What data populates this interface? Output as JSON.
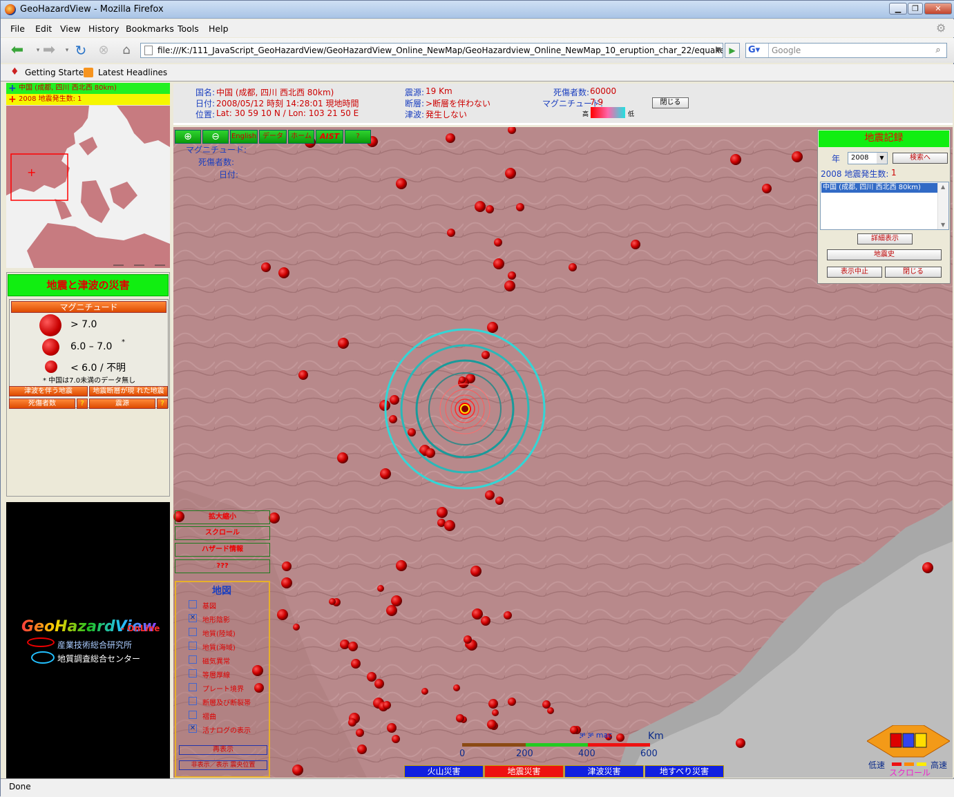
{
  "window": {
    "title": "GeoHazardView - Mozilla Firefox"
  },
  "menu": [
    "File",
    "Edit",
    "View",
    "History",
    "Bookmarks",
    "Tools",
    "Help"
  ],
  "nav": {
    "url": "file:///K:/111_JavaScript_GeoHazardView/GeoHazardView_Online_NewMap/GeoHazardview_Online_NewMap_10_eruption_char_22/equake_j_1.htm",
    "search_placeholder": "Google"
  },
  "bookmarks": [
    "Getting Started",
    "Latest Headlines"
  ],
  "left": {
    "bar1": "中国 (成都, 四川 西北西 80km)",
    "bar2": "2008 地震発生数: 1",
    "legend_title": "地震と津波の災害",
    "magnitude_label": "マグニチュード",
    "mag_items": [
      "> 7.0",
      "6.0 – 7.0",
      "< 6.0 / 不明"
    ],
    "asterisk": "*",
    "note": "*  中国は7.0未満のデータ無し",
    "btn_tsunami": "津波を伴う地震",
    "btn_fault": "地震断層が現 れた地震",
    "btn_deaths": "死傷者数",
    "btn_hypo": "震源",
    "q": "?",
    "logo_main": "GeoHazardView",
    "logo_sub": "- OnLine",
    "org1": "産業技術総合研究所",
    "org2": "地質調査総合センター"
  },
  "info": {
    "country_label": "国名:",
    "country": "中国 (成都, 四川 西北西 80km)",
    "date_label": "日付:",
    "date": "2008/05/12 時刻 14:28:01 現地時間",
    "pos_label": "位置:",
    "pos": "Lat: 30 59 10 N / Lon: 103 21 50 E",
    "depth_label": "震源:",
    "depth": "19 Km",
    "fault_label": "断層:",
    "fault": ">断層を伴わない",
    "tsunami_label": "津波:",
    "tsunami": "発生しない",
    "deaths_label": "死傷者数:",
    "deaths": "60000",
    "mag_label": "マグニチュード:",
    "mag": "7.9",
    "high": "高",
    "low": "低",
    "close": "閉じる"
  },
  "toolbar": {
    "zoom_in": "⊕",
    "zoom_out": "⊖",
    "english": "English",
    "data": "データ",
    "home": "ホーム",
    "aist": "AIST",
    "help": "?"
  },
  "map_labels": {
    "mag": "マグニチュード:",
    "deaths": "死傷者数:",
    "date": "日付:"
  },
  "map_menu": [
    "拡大縮小",
    "スクロール",
    "ハザード情報",
    "???"
  ],
  "layers": {
    "title": "地図",
    "items": [
      "基図",
      "地形陰影",
      "地質(陸域)",
      "地質(海域)",
      "磁気異常",
      "等層厚線",
      "プレート境界",
      "断層及び断裂帯",
      "褶曲",
      "活ナログの表示"
    ],
    "checked": [
      false,
      true,
      false,
      false,
      false,
      false,
      false,
      false,
      false,
      true
    ],
    "redraw": "再表示",
    "toggle": "非表示／表示  震央位置"
  },
  "record": {
    "title": "地震記録",
    "year_label": "年",
    "year": "2008",
    "search": "検索へ",
    "count_label": "2008 地震発生数:",
    "count": "1",
    "list": [
      "中国 (成都, 四川 西北西 80km)"
    ],
    "detail": "詳細表示",
    "history": "地震史",
    "stop": "表示中止",
    "close": "閉じる"
  },
  "scale": {
    "unit": "Km",
    "ticks": [
      "0",
      "200",
      "400",
      "600"
    ],
    "label": "ቻ ቻ mac"
  },
  "tabs": [
    "火山災害",
    "地震災害",
    "津波災害",
    "地すべり災害"
  ],
  "scroll": {
    "slow": "低速",
    "fast": "高速",
    "label": "スクロール"
  },
  "status": "Done"
}
